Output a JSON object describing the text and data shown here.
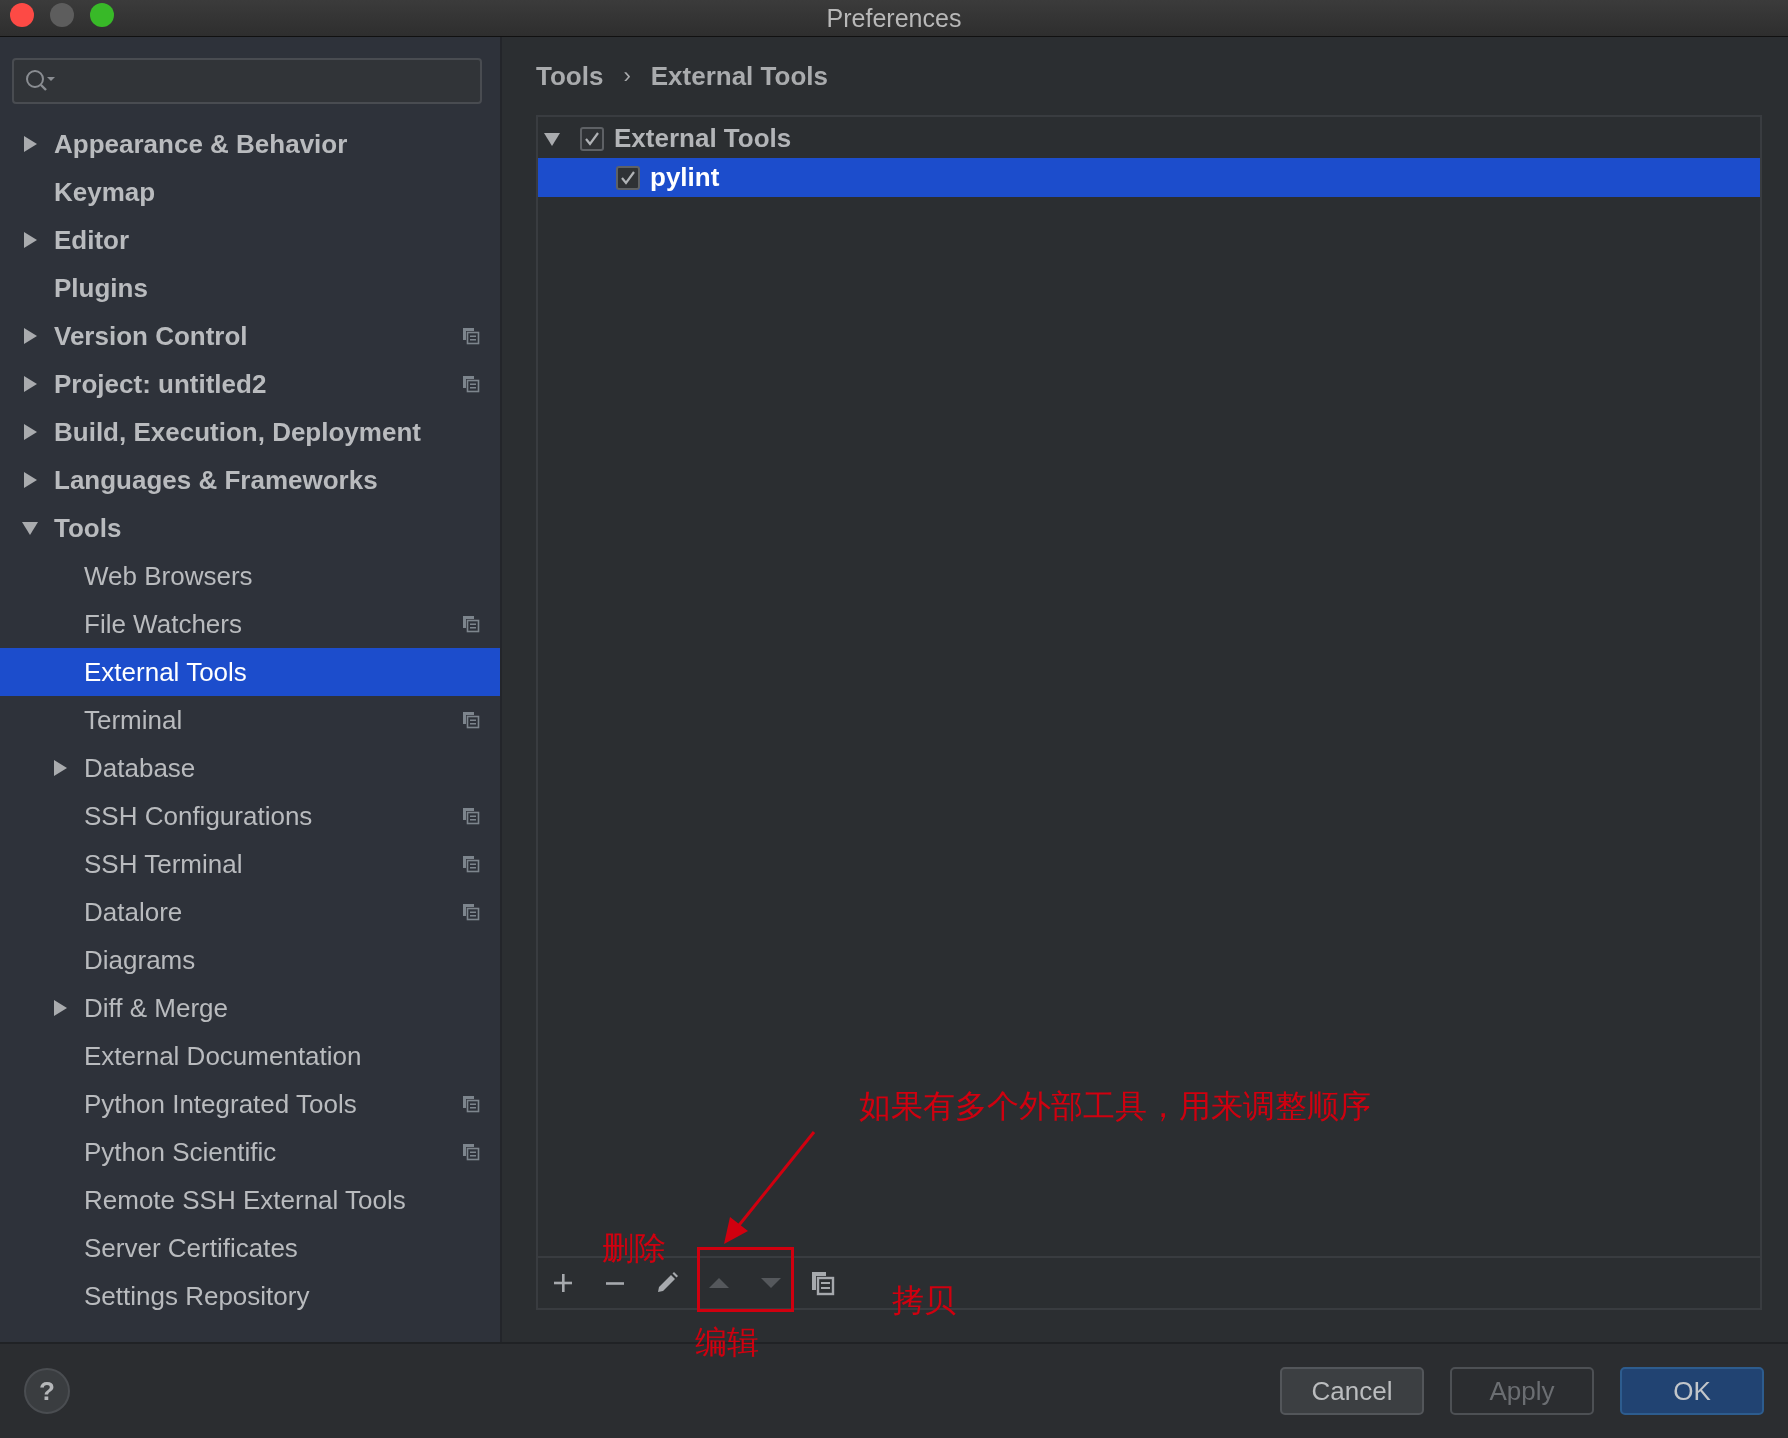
{
  "window": {
    "title": "Preferences"
  },
  "sidebar": {
    "items": [
      {
        "label": "Appearance & Behavior",
        "kind": "folder",
        "expanded": false,
        "selected": false,
        "project_level": false
      },
      {
        "label": "Keymap",
        "kind": "leaf",
        "selected": false,
        "project_level": false
      },
      {
        "label": "Editor",
        "kind": "folder",
        "expanded": false,
        "selected": false,
        "project_level": false
      },
      {
        "label": "Plugins",
        "kind": "leaf",
        "selected": false,
        "project_level": false
      },
      {
        "label": "Version Control",
        "kind": "folder",
        "expanded": false,
        "selected": false,
        "project_level": true
      },
      {
        "label": "Project: untitled2",
        "kind": "folder",
        "expanded": false,
        "selected": false,
        "project_level": true
      },
      {
        "label": "Build, Execution, Deployment",
        "kind": "folder",
        "expanded": false,
        "selected": false,
        "project_level": false
      },
      {
        "label": "Languages & Frameworks",
        "kind": "folder",
        "expanded": false,
        "selected": false,
        "project_level": false
      },
      {
        "label": "Tools",
        "kind": "folder",
        "expanded": true,
        "selected": false,
        "project_level": false,
        "children": [
          {
            "label": "Web Browsers",
            "kind": "leaf",
            "selected": false,
            "project_level": false
          },
          {
            "label": "File Watchers",
            "kind": "leaf",
            "selected": false,
            "project_level": true
          },
          {
            "label": "External Tools",
            "kind": "leaf",
            "selected": true,
            "project_level": false
          },
          {
            "label": "Terminal",
            "kind": "leaf",
            "selected": false,
            "project_level": true
          },
          {
            "label": "Database",
            "kind": "folder",
            "expanded": false,
            "selected": false,
            "project_level": false
          },
          {
            "label": "SSH Configurations",
            "kind": "leaf",
            "selected": false,
            "project_level": true
          },
          {
            "label": "SSH Terminal",
            "kind": "leaf",
            "selected": false,
            "project_level": true
          },
          {
            "label": "Datalore",
            "kind": "leaf",
            "selected": false,
            "project_level": true
          },
          {
            "label": "Diagrams",
            "kind": "leaf",
            "selected": false,
            "project_level": false
          },
          {
            "label": "Diff & Merge",
            "kind": "folder",
            "expanded": false,
            "selected": false,
            "project_level": false
          },
          {
            "label": "External Documentation",
            "kind": "leaf",
            "selected": false,
            "project_level": false
          },
          {
            "label": "Python Integrated Tools",
            "kind": "leaf",
            "selected": false,
            "project_level": true
          },
          {
            "label": "Python Scientific",
            "kind": "leaf",
            "selected": false,
            "project_level": true
          },
          {
            "label": "Remote SSH External Tools",
            "kind": "leaf",
            "selected": false,
            "project_level": false
          },
          {
            "label": "Server Certificates",
            "kind": "leaf",
            "selected": false,
            "project_level": false
          },
          {
            "label": "Settings Repository",
            "kind": "leaf",
            "selected": false,
            "project_level": false
          }
        ]
      }
    ]
  },
  "breadcrumb": [
    "Tools",
    "›",
    "External Tools"
  ],
  "tool_tree": {
    "label": "External Tools",
    "expanded": true,
    "checked": true,
    "selected": false,
    "children": [
      {
        "label": "pylint",
        "checked": true,
        "selected": true
      }
    ]
  },
  "toolbar": [
    {
      "kind": "add",
      "disabled": false
    },
    {
      "kind": "remove",
      "disabled": false
    },
    {
      "kind": "edit",
      "disabled": false
    },
    {
      "kind": "up",
      "disabled": true
    },
    {
      "kind": "down",
      "disabled": true
    },
    {
      "kind": "copy",
      "disabled": false
    }
  ],
  "annotations": [
    "如果有多个外部工具，用来调整顺序",
    "删除",
    "编辑",
    "拷贝"
  ],
  "help_button": "?",
  "buttons": [
    {
      "label": "Cancel",
      "disabled": false,
      "default": false
    },
    {
      "label": "Apply",
      "disabled": true,
      "default": false
    },
    {
      "label": "OK",
      "disabled": false,
      "default": true
    }
  ]
}
